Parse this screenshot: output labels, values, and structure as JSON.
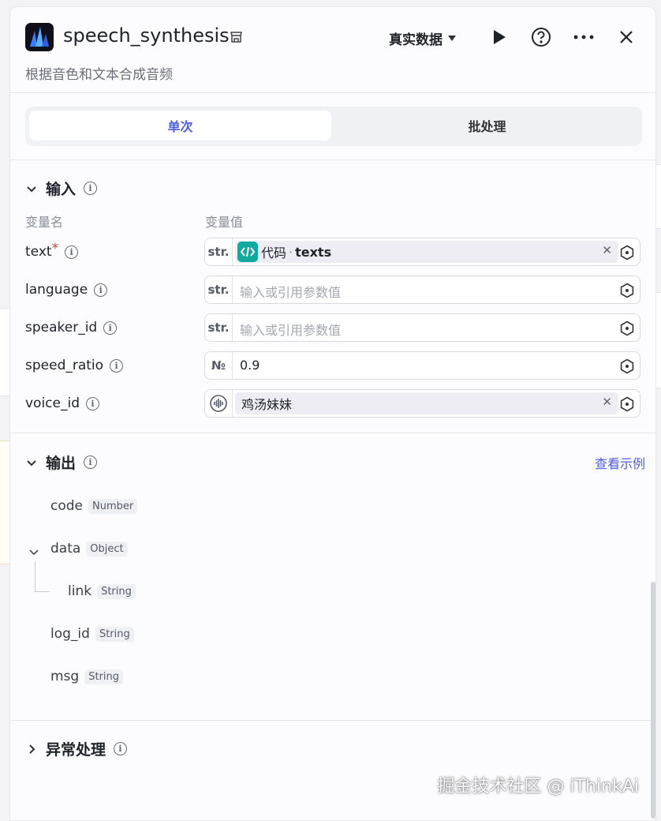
{
  "header": {
    "title": "speech_synthesis",
    "description": "根据音色和文本合成音频",
    "mode_label": "真实数据",
    "colors": {
      "accent": "#4e5ce8",
      "required": "#e0413b",
      "code_chip": "#12a9a0"
    }
  },
  "tabs": [
    {
      "label": "单次",
      "active": true
    },
    {
      "label": "批处理",
      "active": false
    }
  ],
  "input_section": {
    "title": "输入",
    "col_name": "变量名",
    "col_value": "变量值",
    "params": [
      {
        "name": "text",
        "required_mark": "*",
        "type": "str.",
        "chip_source": "代码",
        "chip_sep": "·",
        "chip_var": "texts"
      },
      {
        "name": "language",
        "type": "str.",
        "placeholder": "输入或引用参数值"
      },
      {
        "name": "speaker_id",
        "type": "str.",
        "placeholder": "输入或引用参数值"
      },
      {
        "name": "speed_ratio",
        "type": "№",
        "value": "0.9"
      },
      {
        "name": "voice_id",
        "type_icon": "audio-wave-icon",
        "chip_value": "鸡汤妹妹"
      }
    ]
  },
  "output_section": {
    "title": "输出",
    "example_link": "查看示例",
    "fields": [
      {
        "name": "code",
        "type": "Number"
      },
      {
        "name": "data",
        "type": "Object"
      },
      {
        "name": "link",
        "type": "String"
      },
      {
        "name": "log_id",
        "type": "String"
      },
      {
        "name": "msg",
        "type": "String"
      }
    ]
  },
  "exception_section": {
    "title": "异常处理"
  },
  "watermark": "掘金技术社区 @ iThinkAi"
}
